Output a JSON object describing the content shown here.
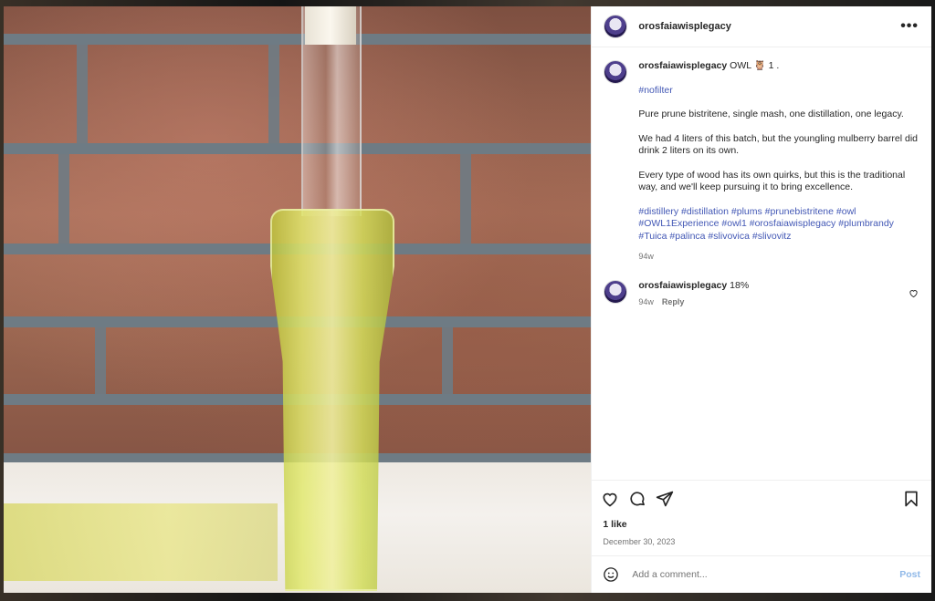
{
  "post": {
    "author": "orosfaiawisplegacy",
    "caption": {
      "author": "orosfaiawisplegacy",
      "headline": "OWL 🦉 1 .",
      "hashtag_line": "#nofilter",
      "paragraphs": [
        "Pure prune bistritene, single mash, one distillation, one legacy.",
        "We had 4 liters of this batch, but the youngling mulberry barrel did drink 2 liters on its own.",
        "Every type of wood has its own quirks, but this is the traditional way, and we'll keep pursuing it to bring excellence."
      ],
      "hashtags": "#distillery #distillation #plums #prunebistritene #owl #OWL1Experience #owl1 #orosfaiawisplegacy #plumbrandy #Tuica #palinca #slivovica #slivovitz",
      "age": "94w"
    },
    "comments": [
      {
        "author": "orosfaiawisplegacy",
        "text": "18%",
        "age": "94w",
        "reply_label": "Reply"
      }
    ],
    "likes": "1 like",
    "date": "December 30, 2023"
  },
  "composer": {
    "placeholder": "Add a comment...",
    "post_label": "Post"
  },
  "icons": {
    "more": "more-horizontal-icon",
    "like": "heart-icon",
    "comment": "comment-bubble-icon",
    "share": "paper-plane-icon",
    "save": "bookmark-icon",
    "emoji": "smiley-face-icon"
  },
  "colors": {
    "hashtag": "#4358b5",
    "post_button": "#8fb8e8",
    "muted_text": "#737373"
  }
}
